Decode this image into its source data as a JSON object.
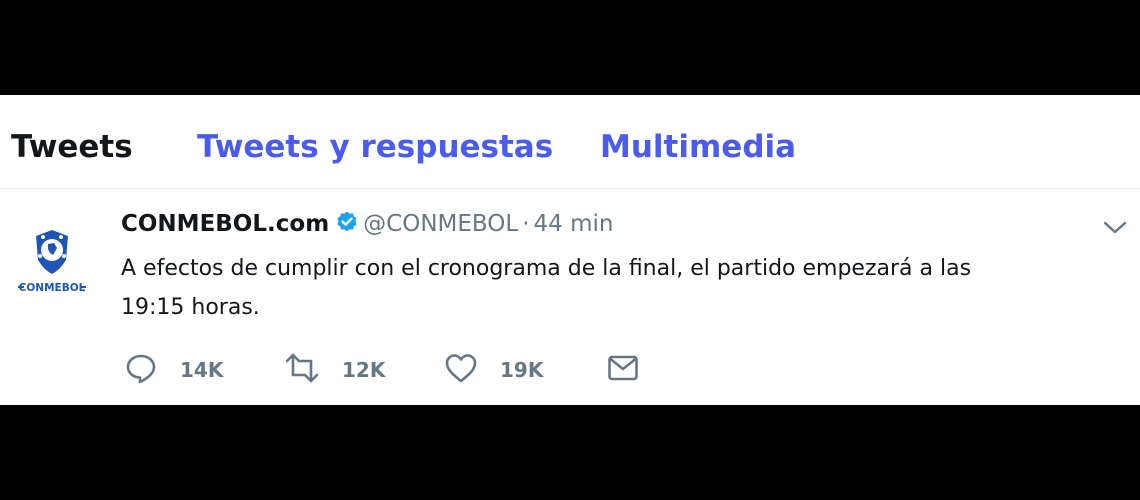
{
  "tabs": [
    {
      "label": "Tweets",
      "active": true
    },
    {
      "label": "Tweets y respuestas",
      "active": false
    },
    {
      "label": "Multimedia",
      "active": false
    }
  ],
  "tweet": {
    "display_name": "CONMEBOL.com",
    "verified": true,
    "handle": "@CONMEBOL",
    "separator": "·",
    "time": "44 min",
    "avatar_text": "CONMEBOL",
    "text_line1": "A efectos de cumplir con el cronograma de la final, el partido empezará a las",
    "text_line2": "19:15 horas.",
    "reply_count": "14K",
    "retweet_count": "12K",
    "like_count": "19K"
  },
  "colors": {
    "accent": "#4a5cf0",
    "verified": "#1da1f2",
    "text": "#14171a",
    "muted": "#657786",
    "letterbox": "#000000"
  },
  "icons": [
    "reply-icon",
    "retweet-icon",
    "like-icon",
    "direct-message-icon",
    "chevron-down-icon",
    "verified-badge-icon"
  ]
}
